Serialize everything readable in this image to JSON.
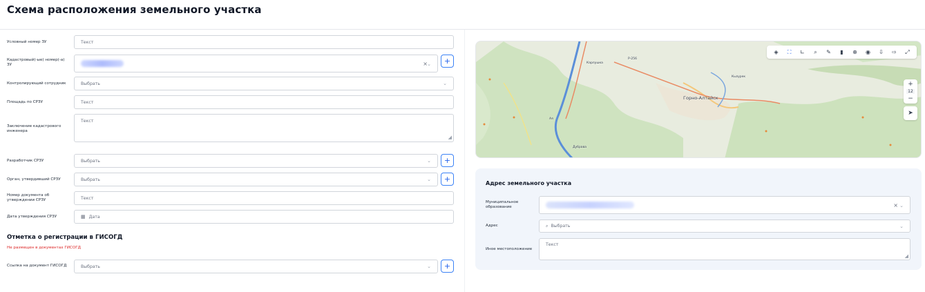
{
  "page": {
    "title": "Схема расположения земельного участка"
  },
  "form": {
    "conditional_number": {
      "label": "Условный номер ЗУ",
      "placeholder": "Текст"
    },
    "cadastral_numbers": {
      "label": "Кадастровый(-ые) номер(-а) ЗУ",
      "clear_icon": "clear-icon",
      "chevron": "chevron-down-icon"
    },
    "controlling_employee": {
      "label": "Контролирующий сотрудник",
      "placeholder": "Выбрать"
    },
    "area": {
      "label": "Площадь по СРЗУ",
      "placeholder": "Текст"
    },
    "engineer_conclusion": {
      "label": "Заключение кадастрового инженера",
      "placeholder": "Текст"
    },
    "developer": {
      "label": "Разработчик СРЗУ",
      "placeholder": "Выбрать"
    },
    "approving_authority": {
      "label": "Орган, утвердивший СРЗУ",
      "placeholder": "Выбрать"
    },
    "approval_doc_number": {
      "label": "Номер документа об утверждении СРЗУ",
      "placeholder": "Текст"
    },
    "approval_date": {
      "label": "Дата утверждения СРЗУ",
      "placeholder": "Дата"
    },
    "plus_label": "+"
  },
  "gisogd": {
    "title": "Отметка о регистрации в ГИСОГД",
    "warning": "Не размещен в документах ГИСОГД",
    "doc_link": {
      "label": "Ссылка на документ ГИСОГД",
      "placeholder": "Выбрать"
    }
  },
  "map": {
    "labels": {
      "city": "Горно-Алтайск",
      "karlushka": "Карлушка",
      "kuzyurek": "Кызурек",
      "aya": "Ая",
      "dubrava": "Дубрава",
      "road": "Р-256"
    },
    "zoom_plus": "+",
    "zoom_level": "12",
    "zoom_minus": "−",
    "toolbar": [
      "layers-icon",
      "select-area-icon",
      "measure-angle-icon",
      "search-icon",
      "pencil-icon",
      "trash-icon",
      "globe-icon",
      "camera-icon",
      "import-icon",
      "export-icon",
      "fullscreen-icon"
    ]
  },
  "address": {
    "title": "Адрес земельного участка",
    "municipality": {
      "label": "Муниципальное образование"
    },
    "address": {
      "label": "Адрес",
      "placeholder": "Выбрать"
    },
    "other_location": {
      "label": "Иное местоположение",
      "placeholder": "Текст"
    }
  },
  "colors": {
    "accent": "#2563eb",
    "warning": "#dc2626",
    "panel_bg": "#f1f5fb"
  }
}
